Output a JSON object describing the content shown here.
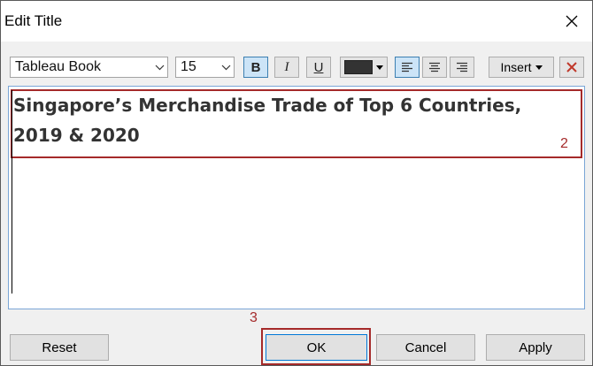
{
  "window": {
    "title": "Edit Title"
  },
  "toolbar": {
    "font_family": "Tableau Book",
    "font_size": "15",
    "bold_label": "B",
    "italic_label": "I",
    "underline_label": "U",
    "text_color": "#333333",
    "insert_label": "Insert"
  },
  "editor": {
    "title_text": "Singapore’s Merchandise Trade of Top 6 Countries, 2019 & 2020"
  },
  "annotations": {
    "step2": "2",
    "step3": "3"
  },
  "buttons": {
    "reset": "Reset",
    "ok": "OK",
    "cancel": "Cancel",
    "apply": "Apply"
  },
  "colors": {
    "annotation": "#a52a2a",
    "active_toggle": "#cce4f7",
    "clear_icon": "#c0392b"
  }
}
